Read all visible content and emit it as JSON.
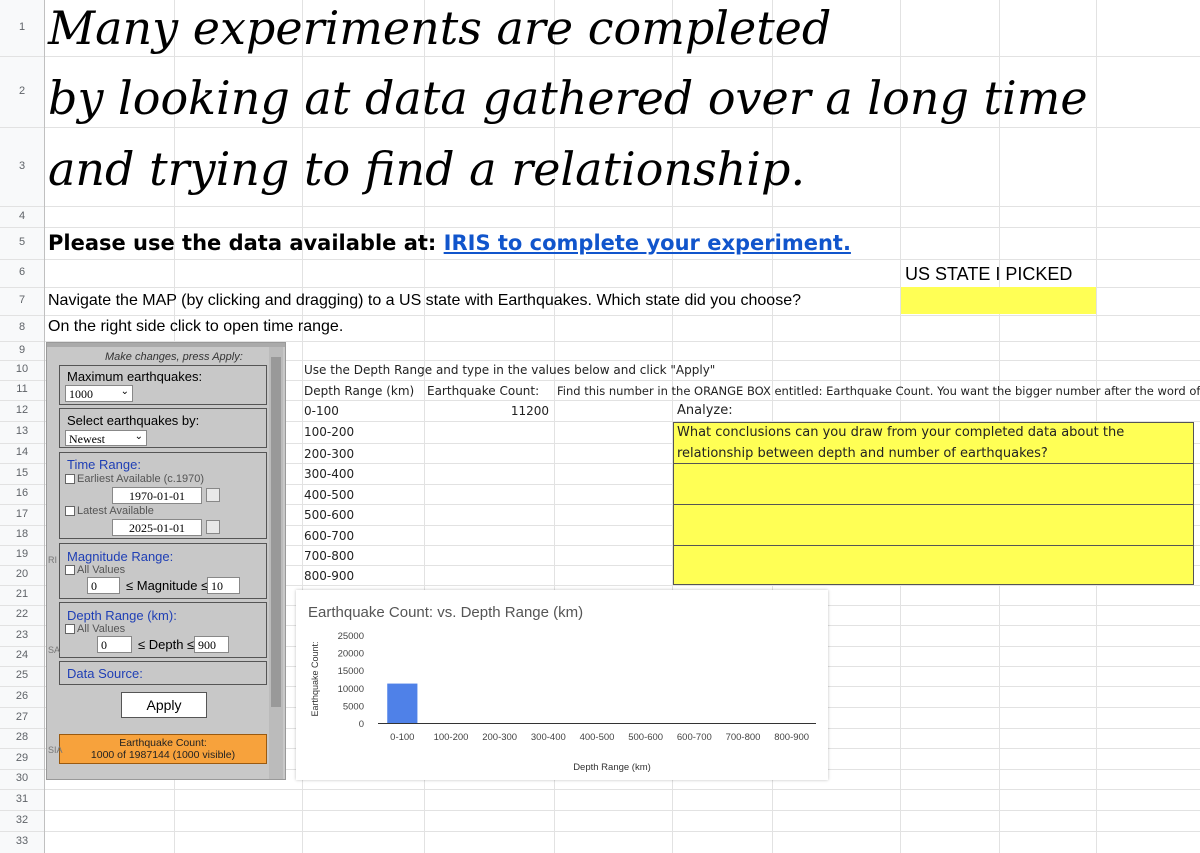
{
  "rows": [
    "1",
    "2",
    "3",
    "4",
    "5",
    "6",
    "7",
    "8",
    "9",
    "10",
    "11",
    "12",
    "13",
    "14",
    "15",
    "16",
    "17",
    "18",
    "19",
    "20",
    "21",
    "22",
    "23",
    "24",
    "25",
    "26",
    "27",
    "28",
    "29",
    "30",
    "31",
    "32",
    "33"
  ],
  "title": {
    "line1": "Many experiments are completed",
    "line2": "by looking at data gathered over a long time",
    "line3": "and trying to find a relationship."
  },
  "instructions": {
    "row5_prefix": "Please use the data available at: ",
    "row5_link": "IRIS to complete your experiment.",
    "state_header": "US STATE I PICKED",
    "row7": "Navigate the MAP (by clicking and dragging) to a US state with Earthquakes. Which state did you choose?",
    "state_value": "",
    "row8": "On the right side click to open time range."
  },
  "table": {
    "intro": "Use the Depth Range and type in the values below and click \"Apply\"",
    "col_depth": "Depth Range (km)",
    "col_count": "Earthquake Count:",
    "note": "Find this number in the ORANGE BOX entitled: Earthquake Count. You want the bigger number after the word of.",
    "rows": [
      {
        "range": "0-100",
        "count": "11200"
      },
      {
        "range": "100-200",
        "count": ""
      },
      {
        "range": "200-300",
        "count": ""
      },
      {
        "range": "300-400",
        "count": ""
      },
      {
        "range": "400-500",
        "count": ""
      },
      {
        "range": "500-600",
        "count": ""
      },
      {
        "range": "600-700",
        "count": ""
      },
      {
        "range": "700-800",
        "count": ""
      },
      {
        "range": "800-900",
        "count": ""
      }
    ]
  },
  "analyze": {
    "label": "Analyze:",
    "question_line1": "What conclusions can you draw from your completed data about the",
    "question_line2": "relationship between depth and number of earthquakes?"
  },
  "iris": {
    "header": "Make changes, press Apply:",
    "max_label": "Maximum earthquakes:",
    "max_value": "1000",
    "select_label": "Select earthquakes by:",
    "select_value": "Newest",
    "time_label": "Time Range:",
    "earliest_label": "Earliest Available (c.1970)",
    "start_date": "1970-01-01",
    "latest_label": "Latest Available",
    "end_date": "2025-01-01",
    "mag_label": "Magnitude Range:",
    "mag_all": "All Values",
    "mag_min": "0",
    "mag_mid": "≤ Magnitude ≤",
    "mag_max": "10",
    "depth_label": "Depth Range (km):",
    "depth_all": "All Values",
    "depth_min": "0",
    "depth_mid": "≤ Depth ≤",
    "depth_max": "900",
    "source_label": "Data Source:",
    "apply": "Apply",
    "count_title": "Earthquake Count:",
    "count_value": "1000 of 1987144 (1000 visible)",
    "map_fragments": [
      "RI",
      "SA",
      "SIA"
    ],
    "colors": {
      "panel": "#c8c8c8",
      "count_box": "#f7a23c",
      "blue_label": "#1f3fb5"
    }
  },
  "chart_data": {
    "type": "bar",
    "title": "Earthquake Count: vs. Depth Range (km)",
    "xlabel": "Depth Range (km)",
    "ylabel": "Earthquake Count:",
    "categories": [
      "0-100",
      "100-200",
      "200-300",
      "300-400",
      "400-500",
      "500-600",
      "600-700",
      "700-800",
      "800-900"
    ],
    "values": [
      11200,
      0,
      0,
      0,
      0,
      0,
      0,
      0,
      0
    ],
    "ylim": [
      0,
      25000
    ],
    "yticks": [
      0,
      5000,
      10000,
      15000,
      20000,
      25000
    ],
    "grid": false,
    "legend": "none",
    "bar_color": "#4f81e8"
  }
}
